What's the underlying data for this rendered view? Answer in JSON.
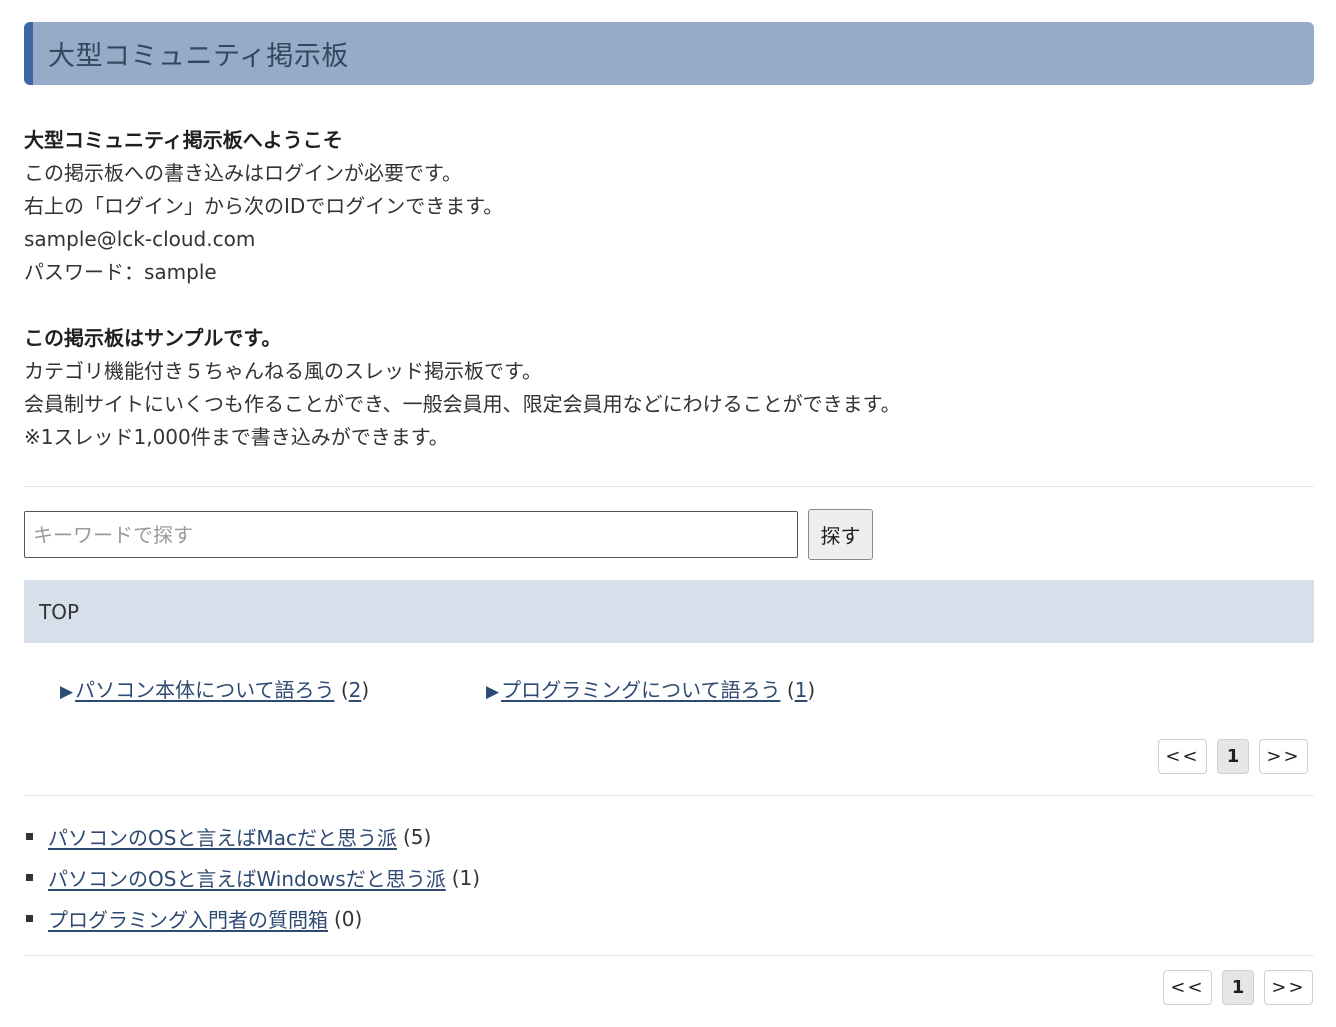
{
  "header": {
    "title": "大型コミュニティ掲示板"
  },
  "intro": {
    "welcome_heading": "大型コミュニティ掲示板へようこそ",
    "lines": [
      "この掲示板への書き込みはログインが必要です。",
      "右上の「ログイン」から次のIDでログインできます。",
      "sample@lck-cloud.com",
      "パスワード：sample"
    ],
    "sample_heading": "この掲示板はサンプルです。",
    "sample_lines": [
      "カテゴリ機能付き５ちゃんねる風のスレッド掲示板です。",
      "会員制サイトにいくつも作ることができ、一般会員用、限定会員用などにわけることができます。",
      "※1スレッド1,000件まで書き込みができます。"
    ]
  },
  "search": {
    "placeholder": "キーワードで探す",
    "value": "",
    "button_label": "探す"
  },
  "breadcrumb": {
    "label": "TOP"
  },
  "categories": [
    {
      "label": "パソコン本体について語ろう",
      "open": "(",
      "count": "2",
      "close": ")"
    },
    {
      "label": "プログラミングについて語ろう",
      "open": "(",
      "count": "1",
      "close": ")"
    }
  ],
  "pagination": {
    "prev": "<<",
    "current": "1",
    "next": ">>"
  },
  "threads": [
    {
      "title": "パソコンのOSと言えばMacだと思う派",
      "count": "(5)"
    },
    {
      "title": "パソコンのOSと言えばWindowsだと思う派",
      "count": "(1)"
    },
    {
      "title": "プログラミング入門者の質問箱",
      "count": "(0)"
    }
  ],
  "icons": {
    "category_marker": "triangle-right-icon",
    "thread_marker": "square-bullet-icon"
  },
  "colors": {
    "header_bg": "#97abc8",
    "header_accent": "#3f67a8",
    "top_bar_bg": "#d6e0eb",
    "link": "#2f4a72"
  }
}
